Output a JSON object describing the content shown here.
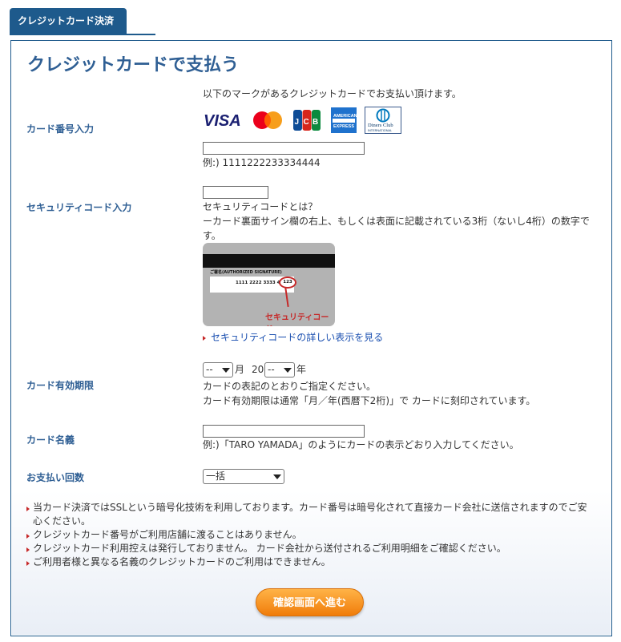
{
  "tab": {
    "label": "クレジットカード決済"
  },
  "page_title": "クレジットカードで支払う",
  "card_number": {
    "label": "カード番号入力",
    "intro": "以下のマークがあるクレジットカードでお支払い頂けます。",
    "example": "例:) 1111222233334444",
    "value": "",
    "brands": [
      "VISA",
      "Mastercard",
      "JCB",
      "American Express",
      "Diners Club"
    ]
  },
  "security_code": {
    "label": "セキュリティコード入力",
    "value": "",
    "heading": "セキュリティコードとは？",
    "desc_line1": "ーカード裏面サイン欄の右上、もしくは表面に記載されている3桁（ないし4桁）の数字で",
    "desc_line2": "す。",
    "card_image": {
      "sig_label": "ご署名(AUTHORIZED SIGNATURE)",
      "card_number": "1111 2222 3333 4444",
      "cvv": "123",
      "caption": "セキュリティコード"
    },
    "detail_link": "セキュリティコードの詳しい表示を見る"
  },
  "expiry": {
    "label": "カード有効期限",
    "month_value": "--",
    "month_unit": "月",
    "year_prefix": "20",
    "year_value": "--",
    "year_unit": "年",
    "note1": "カードの表記のとおりご指定ください。",
    "note2": "カード有効期限は通常「月／年(西暦下2桁)」で カードに刻印されています。"
  },
  "holder": {
    "label": "カード名義",
    "value": "",
    "example": "例:)「TARO YAMADA」のようにカードの表示どおり入力してください。"
  },
  "installments": {
    "label": "お支払い回数",
    "value": "一括"
  },
  "notes": [
    "当カード決済ではSSLという暗号化技術を利用しております。カード番号は暗号化されて直接カード会社に送信されますのでご安心ください。",
    "クレジットカード番号がご利用店舗に渡ることはありません。",
    "クレジットカード利用控えは発行しておりません。 カード会社から送付されるご利用明細をご確認ください。",
    "ご利用者様と異なる名義のクレジットカードのご利用はできません。"
  ],
  "confirm_button": "確認画面へ進む",
  "colors": {
    "accent": "#1e5a8c",
    "title": "#2f5f94",
    "link": "#1a4fb0",
    "bullet": "#c62828",
    "button": "#f07c0a"
  }
}
